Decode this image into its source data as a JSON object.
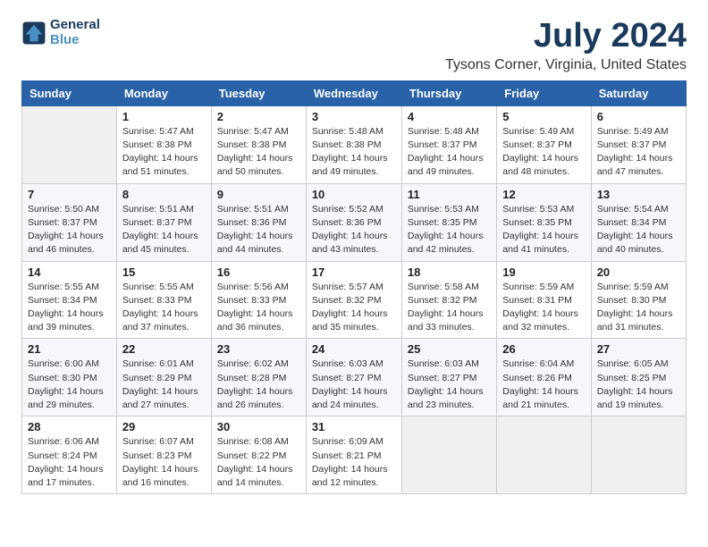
{
  "logo": {
    "line1": "General",
    "line2": "Blue"
  },
  "title": "July 2024",
  "location": "Tysons Corner, Virginia, United States",
  "header_days": [
    "Sunday",
    "Monday",
    "Tuesday",
    "Wednesday",
    "Thursday",
    "Friday",
    "Saturday"
  ],
  "weeks": [
    [
      {
        "day": "",
        "info": ""
      },
      {
        "day": "1",
        "info": "Sunrise: 5:47 AM\nSunset: 8:38 PM\nDaylight: 14 hours\nand 51 minutes."
      },
      {
        "day": "2",
        "info": "Sunrise: 5:47 AM\nSunset: 8:38 PM\nDaylight: 14 hours\nand 50 minutes."
      },
      {
        "day": "3",
        "info": "Sunrise: 5:48 AM\nSunset: 8:38 PM\nDaylight: 14 hours\nand 49 minutes."
      },
      {
        "day": "4",
        "info": "Sunrise: 5:48 AM\nSunset: 8:37 PM\nDaylight: 14 hours\nand 49 minutes."
      },
      {
        "day": "5",
        "info": "Sunrise: 5:49 AM\nSunset: 8:37 PM\nDaylight: 14 hours\nand 48 minutes."
      },
      {
        "day": "6",
        "info": "Sunrise: 5:49 AM\nSunset: 8:37 PM\nDaylight: 14 hours\nand 47 minutes."
      }
    ],
    [
      {
        "day": "7",
        "info": "Sunrise: 5:50 AM\nSunset: 8:37 PM\nDaylight: 14 hours\nand 46 minutes."
      },
      {
        "day": "8",
        "info": "Sunrise: 5:51 AM\nSunset: 8:37 PM\nDaylight: 14 hours\nand 45 minutes."
      },
      {
        "day": "9",
        "info": "Sunrise: 5:51 AM\nSunset: 8:36 PM\nDaylight: 14 hours\nand 44 minutes."
      },
      {
        "day": "10",
        "info": "Sunrise: 5:52 AM\nSunset: 8:36 PM\nDaylight: 14 hours\nand 43 minutes."
      },
      {
        "day": "11",
        "info": "Sunrise: 5:53 AM\nSunset: 8:35 PM\nDaylight: 14 hours\nand 42 minutes."
      },
      {
        "day": "12",
        "info": "Sunrise: 5:53 AM\nSunset: 8:35 PM\nDaylight: 14 hours\nand 41 minutes."
      },
      {
        "day": "13",
        "info": "Sunrise: 5:54 AM\nSunset: 8:34 PM\nDaylight: 14 hours\nand 40 minutes."
      }
    ],
    [
      {
        "day": "14",
        "info": "Sunrise: 5:55 AM\nSunset: 8:34 PM\nDaylight: 14 hours\nand 39 minutes."
      },
      {
        "day": "15",
        "info": "Sunrise: 5:55 AM\nSunset: 8:33 PM\nDaylight: 14 hours\nand 37 minutes."
      },
      {
        "day": "16",
        "info": "Sunrise: 5:56 AM\nSunset: 8:33 PM\nDaylight: 14 hours\nand 36 minutes."
      },
      {
        "day": "17",
        "info": "Sunrise: 5:57 AM\nSunset: 8:32 PM\nDaylight: 14 hours\nand 35 minutes."
      },
      {
        "day": "18",
        "info": "Sunrise: 5:58 AM\nSunset: 8:32 PM\nDaylight: 14 hours\nand 33 minutes."
      },
      {
        "day": "19",
        "info": "Sunrise: 5:59 AM\nSunset: 8:31 PM\nDaylight: 14 hours\nand 32 minutes."
      },
      {
        "day": "20",
        "info": "Sunrise: 5:59 AM\nSunset: 8:30 PM\nDaylight: 14 hours\nand 31 minutes."
      }
    ],
    [
      {
        "day": "21",
        "info": "Sunrise: 6:00 AM\nSunset: 8:30 PM\nDaylight: 14 hours\nand 29 minutes."
      },
      {
        "day": "22",
        "info": "Sunrise: 6:01 AM\nSunset: 8:29 PM\nDaylight: 14 hours\nand 27 minutes."
      },
      {
        "day": "23",
        "info": "Sunrise: 6:02 AM\nSunset: 8:28 PM\nDaylight: 14 hours\nand 26 minutes."
      },
      {
        "day": "24",
        "info": "Sunrise: 6:03 AM\nSunset: 8:27 PM\nDaylight: 14 hours\nand 24 minutes."
      },
      {
        "day": "25",
        "info": "Sunrise: 6:03 AM\nSunset: 8:27 PM\nDaylight: 14 hours\nand 23 minutes."
      },
      {
        "day": "26",
        "info": "Sunrise: 6:04 AM\nSunset: 8:26 PM\nDaylight: 14 hours\nand 21 minutes."
      },
      {
        "day": "27",
        "info": "Sunrise: 6:05 AM\nSunset: 8:25 PM\nDaylight: 14 hours\nand 19 minutes."
      }
    ],
    [
      {
        "day": "28",
        "info": "Sunrise: 6:06 AM\nSunset: 8:24 PM\nDaylight: 14 hours\nand 17 minutes."
      },
      {
        "day": "29",
        "info": "Sunrise: 6:07 AM\nSunset: 8:23 PM\nDaylight: 14 hours\nand 16 minutes."
      },
      {
        "day": "30",
        "info": "Sunrise: 6:08 AM\nSunset: 8:22 PM\nDaylight: 14 hours\nand 14 minutes."
      },
      {
        "day": "31",
        "info": "Sunrise: 6:09 AM\nSunset: 8:21 PM\nDaylight: 14 hours\nand 12 minutes."
      },
      {
        "day": "",
        "info": ""
      },
      {
        "day": "",
        "info": ""
      },
      {
        "day": "",
        "info": ""
      }
    ]
  ]
}
